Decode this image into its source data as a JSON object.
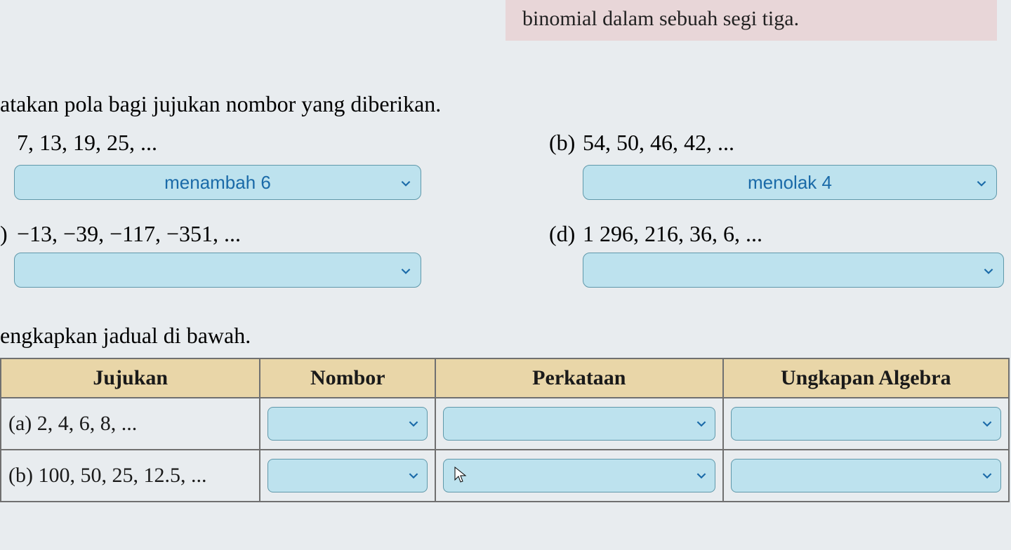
{
  "note": "binomial dalam sebuah segi tiga.",
  "q1": {
    "title": "atakan pola bagi jujukan nombor yang diberikan.",
    "items": {
      "a": {
        "seq": "7, 13, 19, 25, ...",
        "selected": "menambah 6"
      },
      "b": {
        "label": "(b)",
        "seq": "54, 50, 46, 42, ...",
        "selected": "menolak 4"
      },
      "c": {
        "label": ")",
        "seq": "−13, −39, −117, −351, ...",
        "selected": ""
      },
      "d": {
        "label": "(d)",
        "seq": "1 296, 216, 36, 6, ...",
        "selected": ""
      }
    }
  },
  "q2": {
    "title": "engkapkan jadual di bawah.",
    "headers": {
      "jujukan": "Jujukan",
      "nombor": "Nombor",
      "perkataan": "Perkataan",
      "algebra": "Ungkapan Algebra"
    },
    "rows": [
      {
        "label": "(a)  2, 4, 6, 8, ...",
        "nombor": "",
        "perkataan": "",
        "algebra": ""
      },
      {
        "label": "(b)  100, 50, 25, 12.5, ...",
        "nombor": "",
        "perkataan": "",
        "algebra": ""
      }
    ]
  }
}
